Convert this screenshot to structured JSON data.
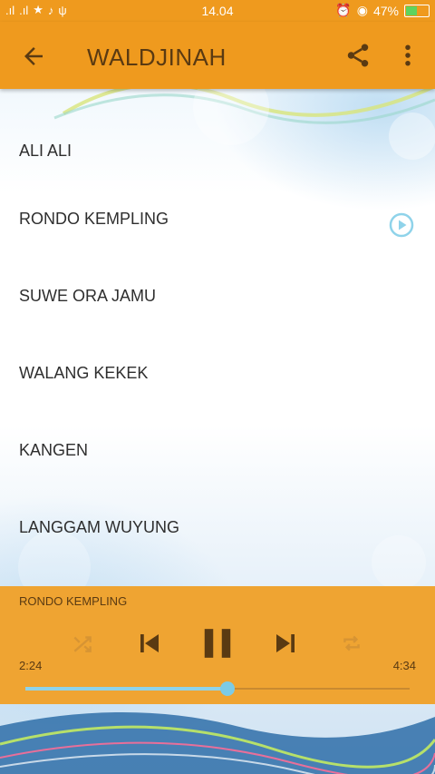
{
  "status_bar": {
    "time": "14.04",
    "battery_text": "47%",
    "battery_level": 0.47
  },
  "app_bar": {
    "title": "WALDJINAH"
  },
  "songs": [
    {
      "title": "ALI ALI"
    },
    {
      "title": "RONDO KEMPLING"
    },
    {
      "title": "SUWE ORA JAMU"
    },
    {
      "title": "WALANG KEKEK"
    },
    {
      "title": "KANGEN"
    },
    {
      "title": "LANGGAM WUYUNG"
    }
  ],
  "player": {
    "now_playing": "RONDO KEMPLING",
    "current_time": "2:24",
    "duration": "4:34",
    "progress": 0.525
  },
  "colors": {
    "accent": "#ef9a1e",
    "player_bg": "#efa432",
    "progress": "#8fd3ea"
  }
}
